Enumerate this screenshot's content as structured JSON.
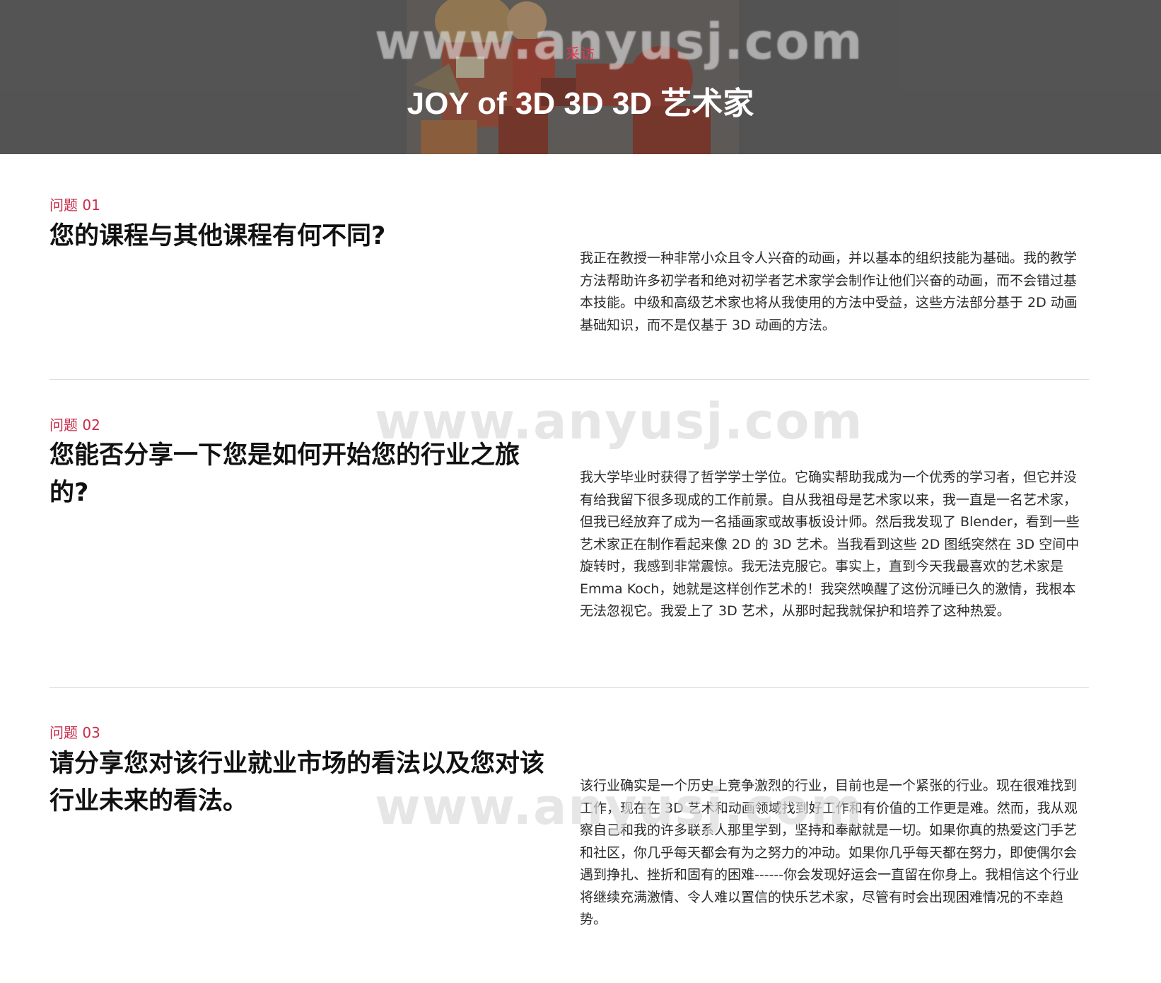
{
  "hero": {
    "kicker": "采访",
    "title": "JOY of 3D 3D 3D 艺术家",
    "watermark": "www.anyusj.com"
  },
  "questions": [
    {
      "label": "问题 01",
      "title": "您的课程与其他课程有何不同?",
      "answer": "我正在教授一种非常小众且令人兴奋的动画，并以基本的组织技能为基础。我的教学方法帮助许多初学者和绝对初学者艺术家学会制作让他们兴奋的动画，而不会错过基本技能。中级和高级艺术家也将从我使用的方法中受益，这些方法部分基于 2D 动画基础知识，而不是仅基于 3D 动画的方法。"
    },
    {
      "label": "问题 02",
      "title": "您能否分享一下您是如何开始您的行业之旅的?",
      "answer": "我大学毕业时获得了哲学学士学位。它确实帮助我成为一个优秀的学习者，但它并没有给我留下很多现成的工作前景。自从我祖母是艺术家以来，我一直是一名艺术家，但我已经放弃了成为一名插画家或故事板设计师。然后我发现了 Blender，看到一些艺术家正在制作看起来像 2D 的 3D 艺术。当我看到这些 2D 图纸突然在 3D 空间中旋转时，我感到非常震惊。我无法克服它。事实上，直到今天我最喜欢的艺术家是 Emma Koch，她就是这样创作艺术的！我突然唤醒了这份沉睡已久的激情，我根本无法忽视它。我爱上了 3D 艺术，从那时起我就保护和培养了这种热爱。"
    },
    {
      "label": "问题 03",
      "title": "请分享您对该行业就业市场的看法以及您对该行业未来的看法。",
      "answer": "该行业确实是一个历史上竞争激烈的行业，目前也是一个紧张的行业。现在很难找到工作，现在在 3D 艺术和动画领域找到好工作和有价值的工作更是难。然而，我从观察自己和我的许多联系人那里学到，坚持和奉献就是一切。如果你真的热爱这门手艺和社区，你几乎每天都会有为之努力的冲动。如果你几乎每天都在努力，即使偶尔会遇到挣扎、挫折和固有的困难------你会发现好运会一直留在你身上。我相信这个行业将继续充满激情、令人难以置信的快乐艺术家，尽管有时会出现困难情况的不幸趋势。"
    }
  ],
  "colors": {
    "accent": "#c92a4a",
    "kicker": "#e8354f",
    "hero_bg": "#5b5b5b"
  }
}
